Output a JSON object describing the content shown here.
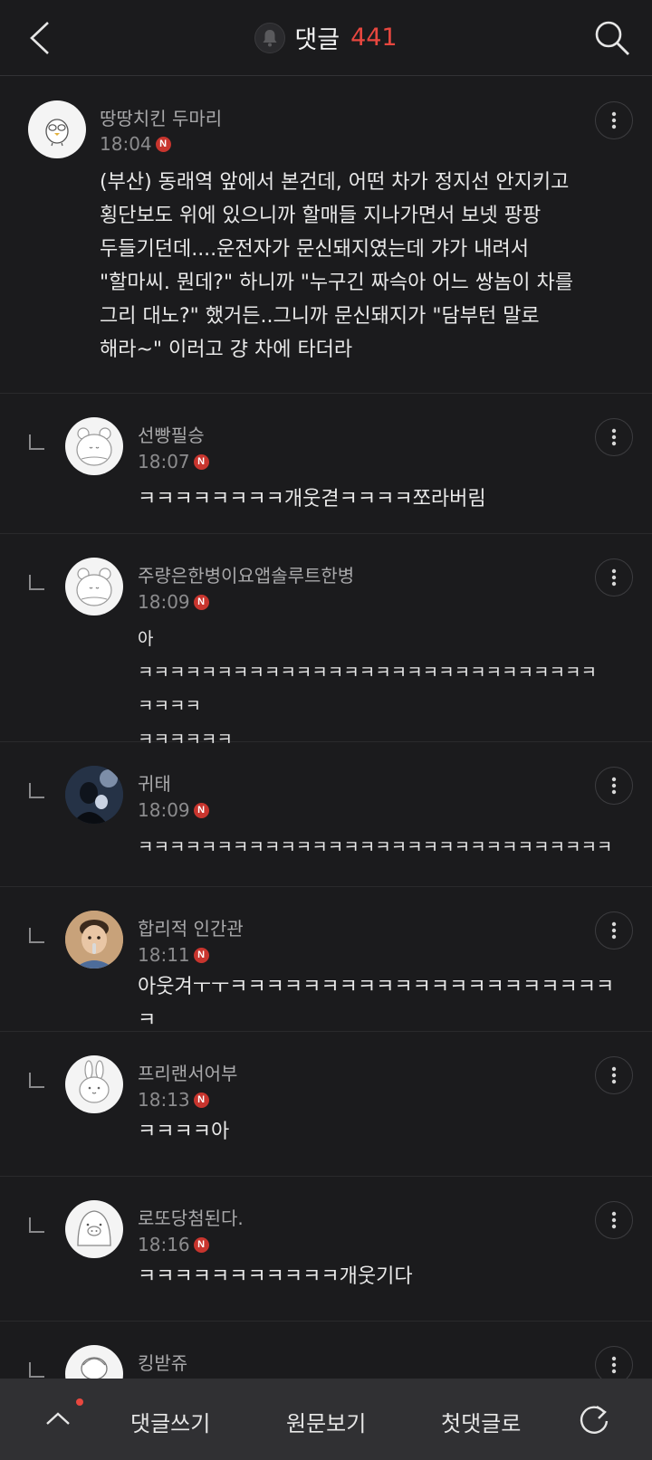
{
  "header": {
    "title": "댓글",
    "count": "441"
  },
  "comments": [
    {
      "author": "땅땅치킨 두마리",
      "time": "18:04",
      "badge": "N",
      "text": "(부산) 동래역 앞에서 본건데, 어떤 차가 정지선 안지키고\n횡단보도 위에 있으니까 할매들 지나가면서 보넷 팡팡\n두들기던데....운전자가 문신돼지였는데 갸가 내려서\n\"할마씨. 뭔데?\" 하니까 \"누구긴 짜슥아 어느 쌍놈이 차를\n그리 대노?\" 했거든..그니까 문신돼지가 \"담부턴 말로\n해라~\" 이러고 걍 차에 타더라",
      "avatar_icon": "chick-avatar-icon"
    },
    {
      "author": "선빵필승",
      "time": "18:07",
      "badge": "N",
      "text": "ㅋㅋㅋㅋㅋㅋㅋㅋ개웃겯ㅋㅋㅋㅋ쪼라버림",
      "avatar_icon": "bear-avatar-icon"
    },
    {
      "author": "주량은한병이요앱솔루트한병",
      "time": "18:09",
      "badge": "N",
      "text": "아\nㅋㅋㅋㅋㅋㅋㅋㅋㅋㅋㅋㅋㅋㅋㅋㅋㅋㅋㅋㅋㅋㅋㅋㅋㅋㅋㅋㅋㅋㅋㅋㅋㅋ\nㅋㅋㅋㅋㅋㅋ",
      "avatar_icon": "bear-avatar-icon"
    },
    {
      "author": "귀태",
      "time": "18:09",
      "badge": "N",
      "text": "ㅋㅋㅋㅋㅋㅋㅋㅋㅋㅋㅋㅋㅋㅋㅋㅋㅋㅋㅋㅋㅋㅋㅋㅋㅋㅋㅋㅋㅋㅋ",
      "avatar_icon": "photo-avatar-icon"
    },
    {
      "author": "합리적 인간관",
      "time": "18:11",
      "badge": "N",
      "text": "아웃겨ㅜㅜㅋㅋㅋㅋㅋㅋㅋㅋㅋㅋㅋㅋㅋㅋㅋㅋㅋㅋㅋㅋㅋㅋ",
      "avatar_icon": "child-photo-avatar-icon"
    },
    {
      "author": "프리랜서어부",
      "time": "18:13",
      "badge": "N",
      "text": "ㅋㅋㅋㅋ아",
      "avatar_icon": "rabbit-avatar-icon"
    },
    {
      "author": "로또당첨된다.",
      "time": "18:16",
      "badge": "N",
      "text": "ㅋㅋㅋㅋㅋㅋㅋㅋㅋㅋㅋ개웃기다",
      "avatar_icon": "pig-avatar-icon"
    },
    {
      "author": "킹받쥬",
      "time": "",
      "badge": "",
      "text": "",
      "avatar_icon": "character-avatar-icon"
    }
  ],
  "bottom_bar": {
    "write": "댓글쓰기",
    "original": "원문보기",
    "first": "첫댓글로"
  },
  "colors": {
    "background": "#1b1b1d",
    "accent": "#e8473f",
    "bottom_bar": "#303033"
  }
}
